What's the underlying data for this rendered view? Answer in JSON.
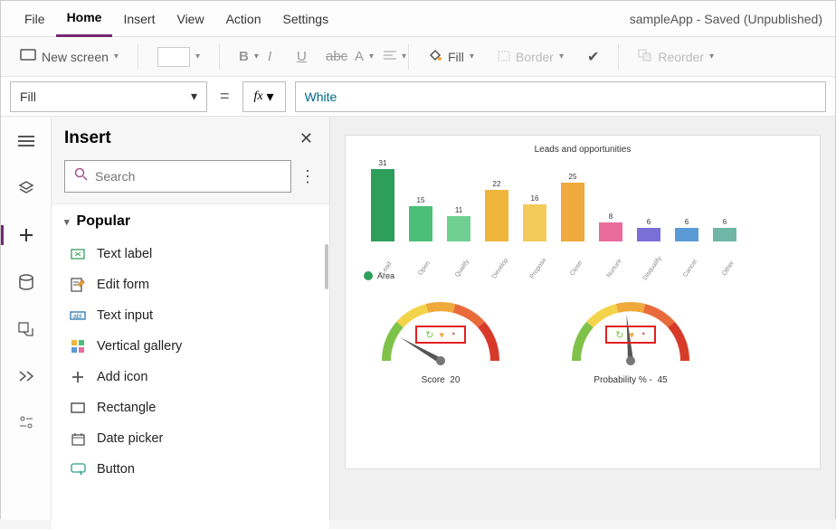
{
  "menu": {
    "items": [
      "File",
      "Home",
      "Insert",
      "View",
      "Action",
      "Settings"
    ],
    "active": "Home"
  },
  "app_title": "sampleApp - Saved (Unpublished)",
  "ribbon": {
    "new_screen": "New screen",
    "fill": "Fill",
    "border": "Border",
    "reorder": "Reorder"
  },
  "formula": {
    "property": "Fill",
    "fx": "fx",
    "value": "White"
  },
  "insert": {
    "title": "Insert",
    "search_placeholder": "Search",
    "category": "Popular",
    "items": [
      {
        "icon": "text-label",
        "label": "Text label"
      },
      {
        "icon": "edit-form",
        "label": "Edit form"
      },
      {
        "icon": "text-input",
        "label": "Text input"
      },
      {
        "icon": "vertical-gallery",
        "label": "Vertical gallery"
      },
      {
        "icon": "add-icon",
        "label": "Add icon"
      },
      {
        "icon": "rectangle",
        "label": "Rectangle"
      },
      {
        "icon": "date-picker",
        "label": "Date picker"
      },
      {
        "icon": "button",
        "label": "Button"
      }
    ]
  },
  "chart_data": {
    "type": "bar",
    "title": "Leads and opportunities",
    "categories": [
      "Lead",
      "Open",
      "Qualify",
      "Develop",
      "Propose",
      "Close",
      "Nurture",
      "Disqualify",
      "Cancel",
      "Other"
    ],
    "values": [
      31,
      15,
      11,
      22,
      16,
      25,
      8,
      6,
      6,
      6
    ],
    "colors": [
      "#2e9e5b",
      "#4bbf78",
      "#6fd092",
      "#f0b63c",
      "#f3c95a",
      "#f0a93c",
      "#e96b9c",
      "#7a6fd6",
      "#5a9bd6",
      "#6fb6a6"
    ],
    "legend": "Area"
  },
  "gauges": [
    {
      "label": "Score",
      "value": 20,
      "angle": -60
    },
    {
      "label": "Probability %  -",
      "value": 45,
      "angle": -5
    }
  ]
}
